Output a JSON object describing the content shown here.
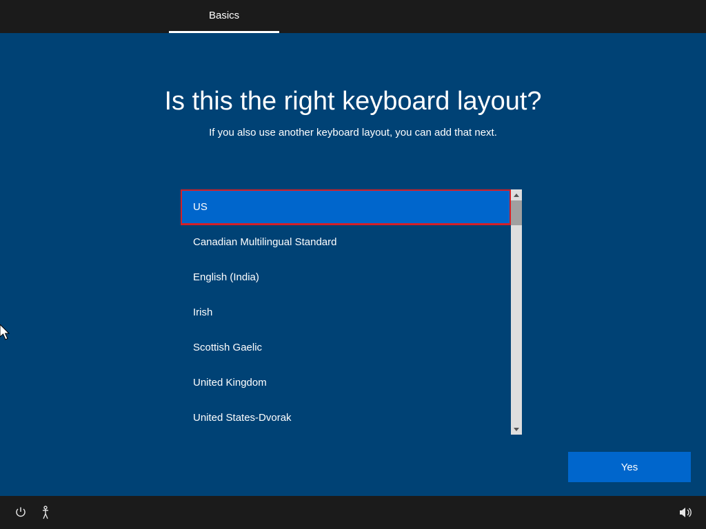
{
  "tab": {
    "label": "Basics"
  },
  "heading": "Is this the right keyboard layout?",
  "subheading": "If you also use another keyboard layout, you can add that next.",
  "layouts": [
    "US",
    "Canadian Multilingual Standard",
    "English (India)",
    "Irish",
    "Scottish Gaelic",
    "United Kingdom",
    "United States-Dvorak"
  ],
  "selected_index": 0,
  "buttons": {
    "yes": "Yes"
  }
}
